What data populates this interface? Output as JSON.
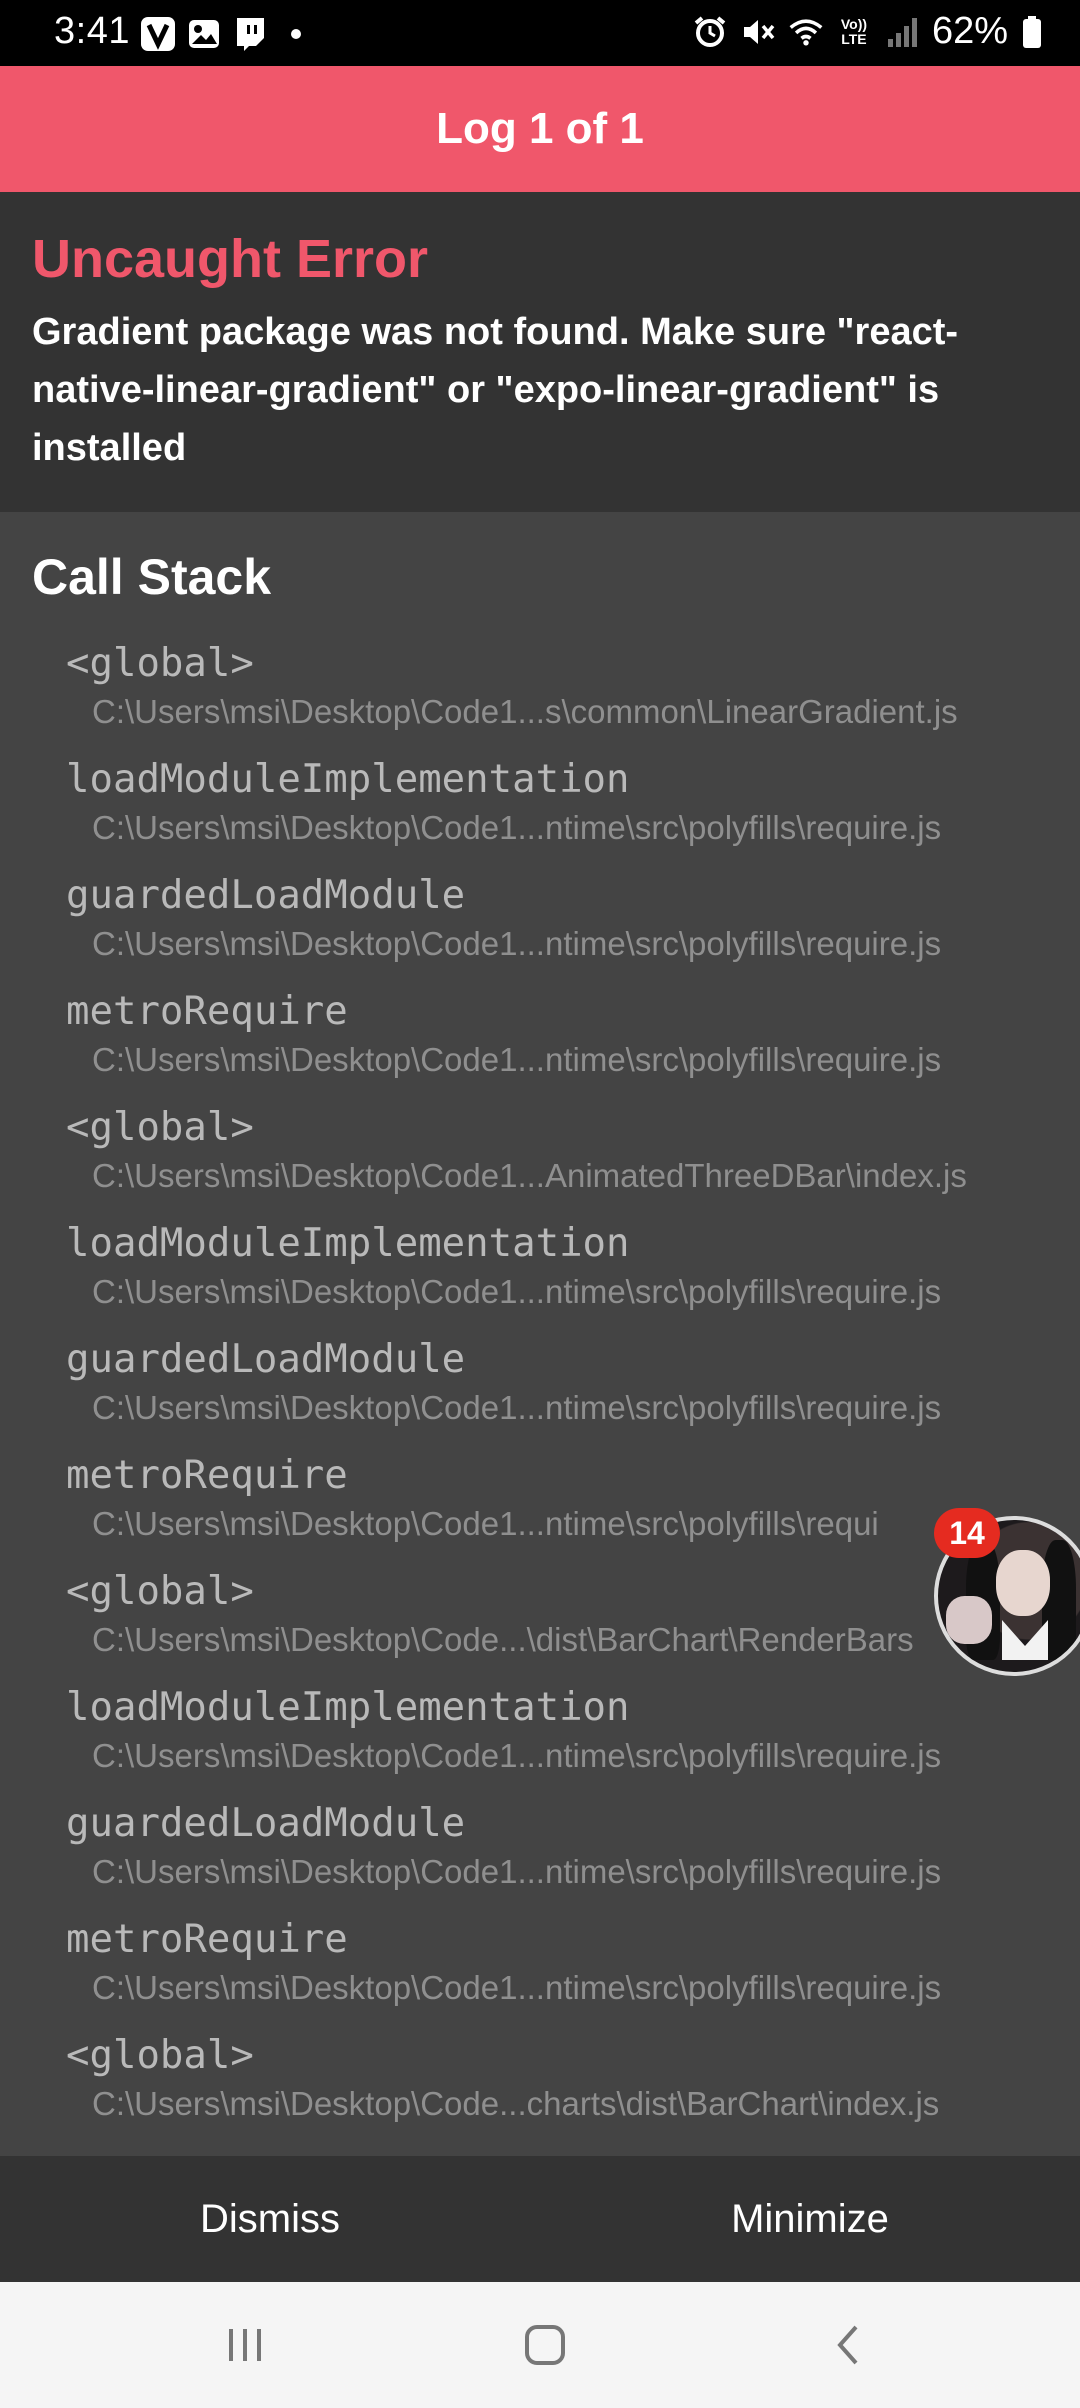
{
  "status_bar": {
    "time": "3:41",
    "left_icons": [
      "v-app-icon",
      "gallery-icon",
      "twitch-icon",
      "dot-icon"
    ],
    "right_icons": [
      "alarm-icon",
      "mute-icon",
      "wifi-icon",
      "volte-icon",
      "signal-icon",
      "battery-icon"
    ],
    "volte_text": "Vo)) LTE",
    "battery": "62%"
  },
  "header": {
    "title": "Log 1 of 1",
    "bg_color": "#f0576b"
  },
  "error": {
    "title": "Uncaught Error",
    "message": "Gradient package was not found. Make sure \"react-native-linear-gradient\" or \"expo-linear-gradient\" is installed"
  },
  "call_stack": {
    "title": "Call Stack",
    "frames": [
      {
        "name": "<global>",
        "path": "C:\\Users\\msi\\Desktop\\Code1...s\\common\\LinearGradient.js"
      },
      {
        "name": "loadModuleImplementation",
        "path": "C:\\Users\\msi\\Desktop\\Code1...ntime\\src\\polyfills\\require.js"
      },
      {
        "name": "guardedLoadModule",
        "path": "C:\\Users\\msi\\Desktop\\Code1...ntime\\src\\polyfills\\require.js"
      },
      {
        "name": "metroRequire",
        "path": "C:\\Users\\msi\\Desktop\\Code1...ntime\\src\\polyfills\\require.js"
      },
      {
        "name": "<global>",
        "path": "C:\\Users\\msi\\Desktop\\Code1...AnimatedThreeDBar\\index.js"
      },
      {
        "name": "loadModuleImplementation",
        "path": "C:\\Users\\msi\\Desktop\\Code1...ntime\\src\\polyfills\\require.js"
      },
      {
        "name": "guardedLoadModule",
        "path": "C:\\Users\\msi\\Desktop\\Code1...ntime\\src\\polyfills\\require.js"
      },
      {
        "name": "metroRequire",
        "path": "C:\\Users\\msi\\Desktop\\Code1...ntime\\src\\polyfills\\requi"
      },
      {
        "name": "<global>",
        "path": "C:\\Users\\msi\\Desktop\\Code...\\dist\\BarChart\\RenderBars"
      },
      {
        "name": "loadModuleImplementation",
        "path": "C:\\Users\\msi\\Desktop\\Code1...ntime\\src\\polyfills\\require.js"
      },
      {
        "name": "guardedLoadModule",
        "path": "C:\\Users\\msi\\Desktop\\Code1...ntime\\src\\polyfills\\require.js"
      },
      {
        "name": "metroRequire",
        "path": "C:\\Users\\msi\\Desktop\\Code1...ntime\\src\\polyfills\\require.js"
      },
      {
        "name": "<global>",
        "path": "C:\\Users\\msi\\Desktop\\Code...charts\\dist\\BarChart\\index.js"
      }
    ]
  },
  "chat_head": {
    "badge_count": "14"
  },
  "actions": {
    "dismiss": "Dismiss",
    "minimize": "Minimize"
  },
  "navbar": {
    "icons": [
      "recent-apps-icon",
      "home-icon",
      "back-icon"
    ]
  }
}
